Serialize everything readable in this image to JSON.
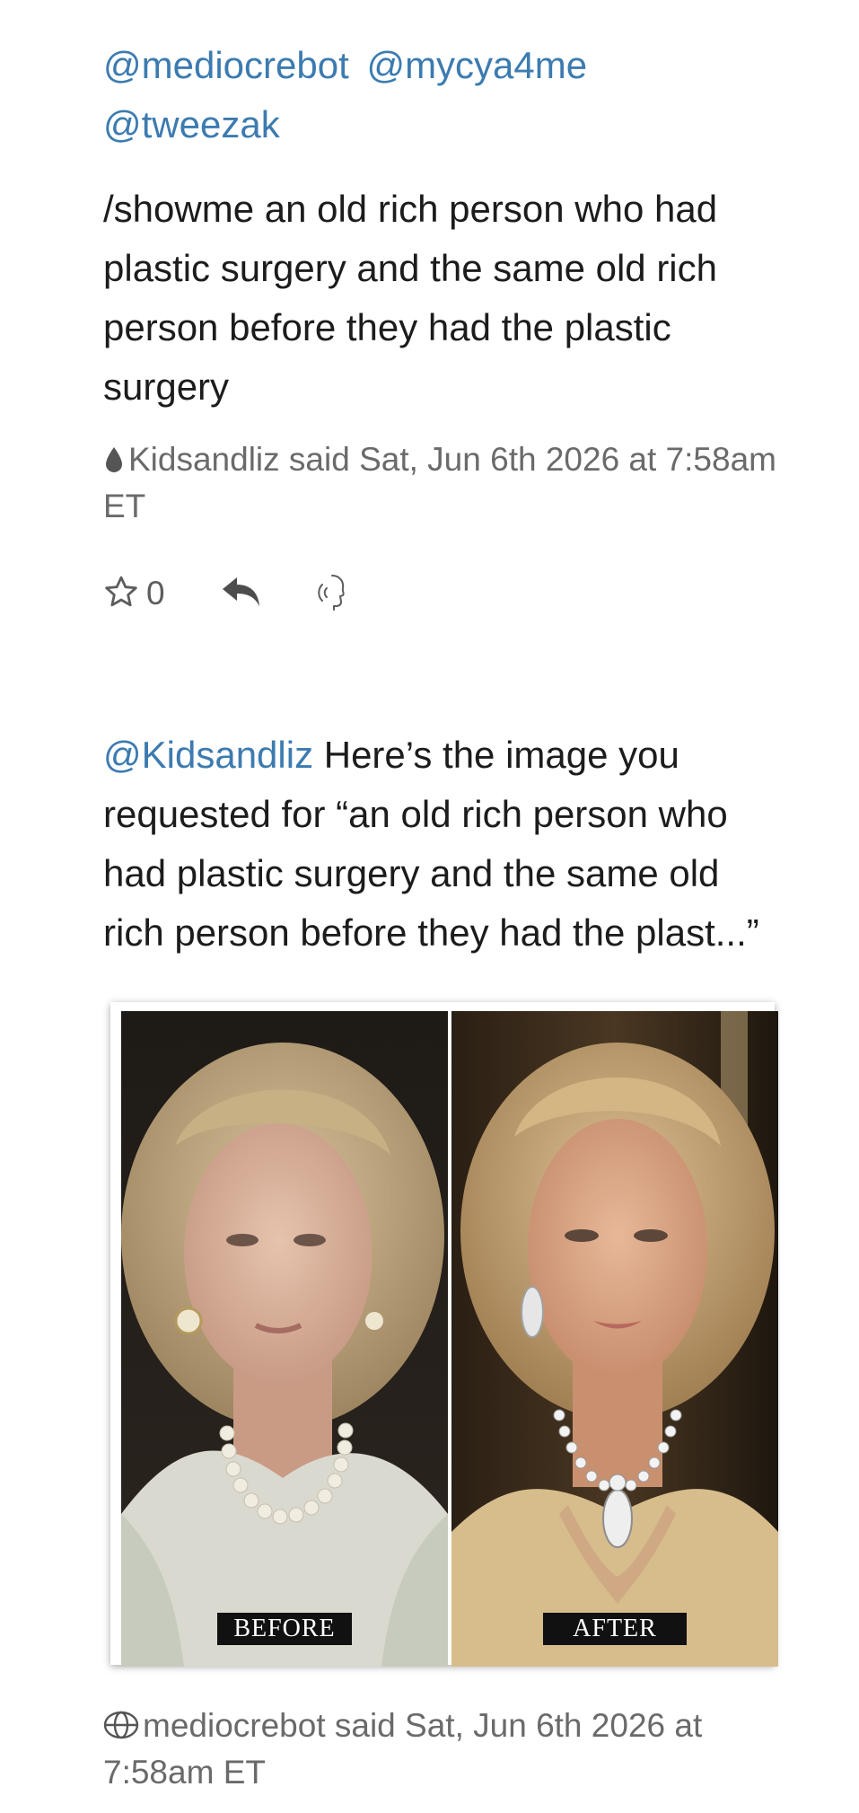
{
  "post1": {
    "mentions": [
      "@mediocrebot",
      "@mycya4me",
      "@tweezak"
    ],
    "body": "/showme an old rich person who had plastic surgery and the same old rich person before they had the plastic surgery",
    "meta": "Kidsandliz said Sat, Jun 6th 2026 at 7:58am ET",
    "meta_icon": "drop-icon",
    "actions": {
      "star_count": "0",
      "star_icon": "star-icon",
      "reply_icon": "reply-icon",
      "audio_icon": "speak-icon"
    }
  },
  "post2": {
    "mention": "@Kidsandliz",
    "body": " Here’s the image you requested for “an old rich person who had plastic surgery and the same old rich person before they had the plast...”",
    "image": {
      "left_label": "BEFORE",
      "right_label": "AFTER"
    },
    "meta": "mediocrebot said Sat, Jun 6th 2026 at 7:58am ET",
    "meta_icon": "globe-icon"
  },
  "colors": {
    "link": "#3c7bb0",
    "text": "#1c1c1c",
    "meta": "#6a6a6a"
  }
}
